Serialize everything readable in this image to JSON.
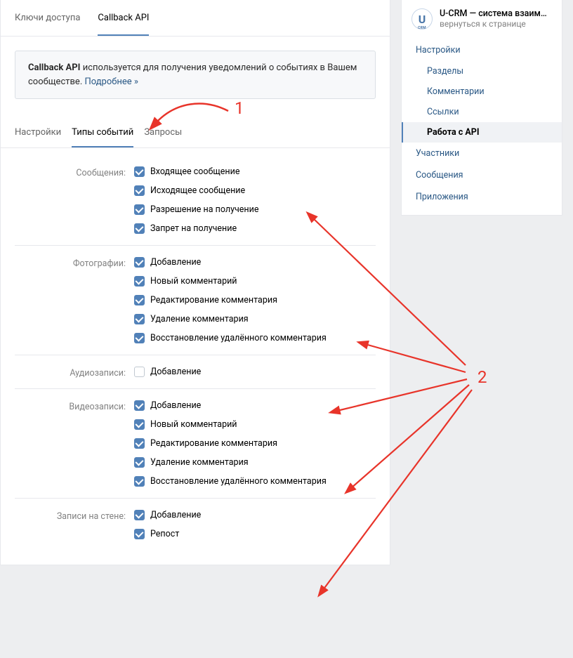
{
  "top_tabs": [
    {
      "label": "Ключи доступа",
      "active": false
    },
    {
      "label": "Callback API",
      "active": true
    }
  ],
  "info": {
    "bold": "Callback API",
    "text": " используется для получения уведомлений о событиях в Вашем сообществе. ",
    "link": "Подробнее »"
  },
  "sub_tabs": [
    {
      "label": "Настройки",
      "active": false
    },
    {
      "label": "Типы событий",
      "active": true
    },
    {
      "label": "Запросы",
      "active": false
    }
  ],
  "groups": [
    {
      "label": "Сообщения:",
      "options": [
        {
          "label": "Входящее сообщение",
          "checked": true
        },
        {
          "label": "Исходящее сообщение",
          "checked": true
        },
        {
          "label": "Разрешение на получение",
          "checked": true
        },
        {
          "label": "Запрет на получение",
          "checked": true
        }
      ]
    },
    {
      "label": "Фотографии:",
      "options": [
        {
          "label": "Добавление",
          "checked": true
        },
        {
          "label": "Новый комментарий",
          "checked": true
        },
        {
          "label": "Редактирование комментария",
          "checked": true
        },
        {
          "label": "Удаление комментария",
          "checked": true
        },
        {
          "label": "Восстановление удалённого комментария",
          "checked": true
        }
      ]
    },
    {
      "label": "Аудиозаписи:",
      "options": [
        {
          "label": "Добавление",
          "checked": false
        }
      ]
    },
    {
      "label": "Видеозаписи:",
      "options": [
        {
          "label": "Добавление",
          "checked": true
        },
        {
          "label": "Новый комментарий",
          "checked": true
        },
        {
          "label": "Редактирование комментария",
          "checked": true
        },
        {
          "label": "Удаление комментария",
          "checked": true
        },
        {
          "label": "Восстановление удалённого комментария",
          "checked": true
        }
      ]
    },
    {
      "label": "Записи на стене:",
      "options": [
        {
          "label": "Добавление",
          "checked": true
        },
        {
          "label": "Репост",
          "checked": true
        }
      ]
    }
  ],
  "sidebar": {
    "logo_text": "U",
    "logo_sub": "CRM",
    "title": "U-CRM — система взаим…",
    "subtitle": "вернуться к странице",
    "menu": [
      {
        "label": "Настройки",
        "sub": [
          {
            "label": "Разделы",
            "active": false
          },
          {
            "label": "Комментарии",
            "active": false
          },
          {
            "label": "Ссылки",
            "active": false
          },
          {
            "label": "Работа с API",
            "active": true
          }
        ]
      },
      {
        "label": "Участники"
      },
      {
        "label": "Сообщения"
      },
      {
        "label": "Приложения"
      }
    ]
  },
  "annotations": {
    "label1": "1",
    "label2": "2"
  }
}
